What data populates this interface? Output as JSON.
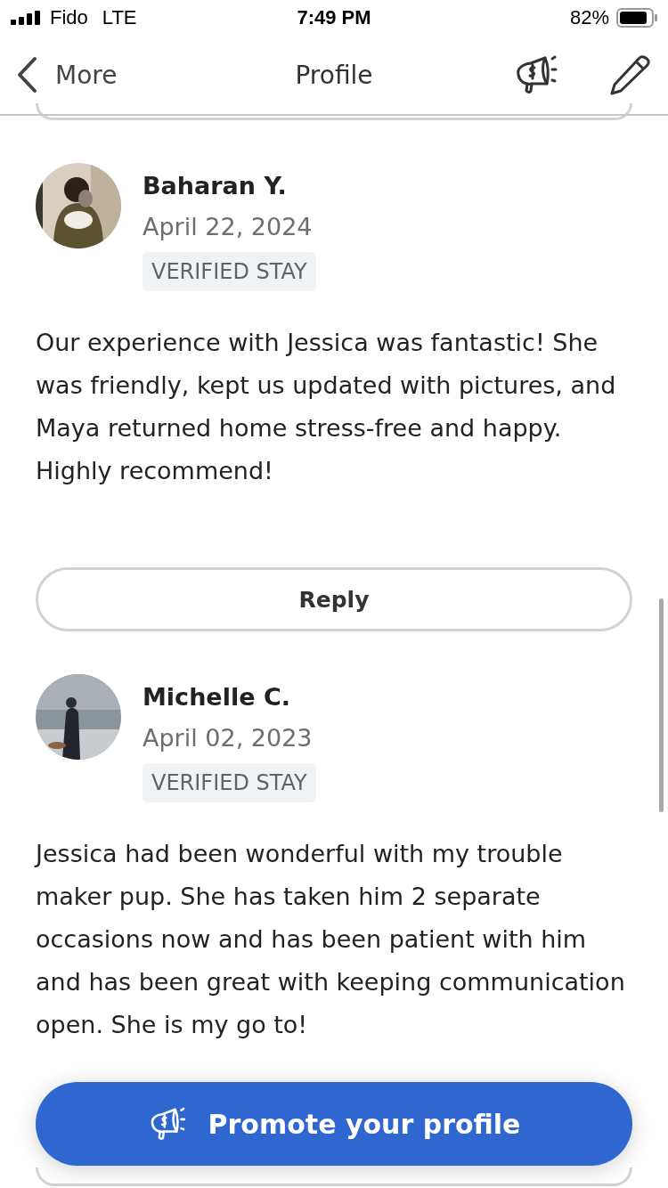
{
  "status_bar": {
    "carrier": "Fido",
    "network": "LTE",
    "time": "7:49 PM",
    "battery": "82%"
  },
  "nav": {
    "back": "More",
    "title": "Profile"
  },
  "reviews": [
    {
      "name": "Baharan Y.",
      "date": "April 22, 2024",
      "badge": "VERIFIED STAY",
      "text": "Our experience with Jessica was fantastic! She was friendly, kept us updated with pictures, and Maya returned home stress-free and happy. Highly recommend!",
      "reply": "Reply"
    },
    {
      "name": "Michelle C.",
      "date": "April 02, 2023",
      "badge": "VERIFIED STAY",
      "text": "Jessica had been wonderful with my trouble maker pup. She has taken him 2 separate occasions now and has been patient with him and has been great with keeping communication open. She is my go to!"
    }
  ],
  "promote_button": "Promote your profile"
}
